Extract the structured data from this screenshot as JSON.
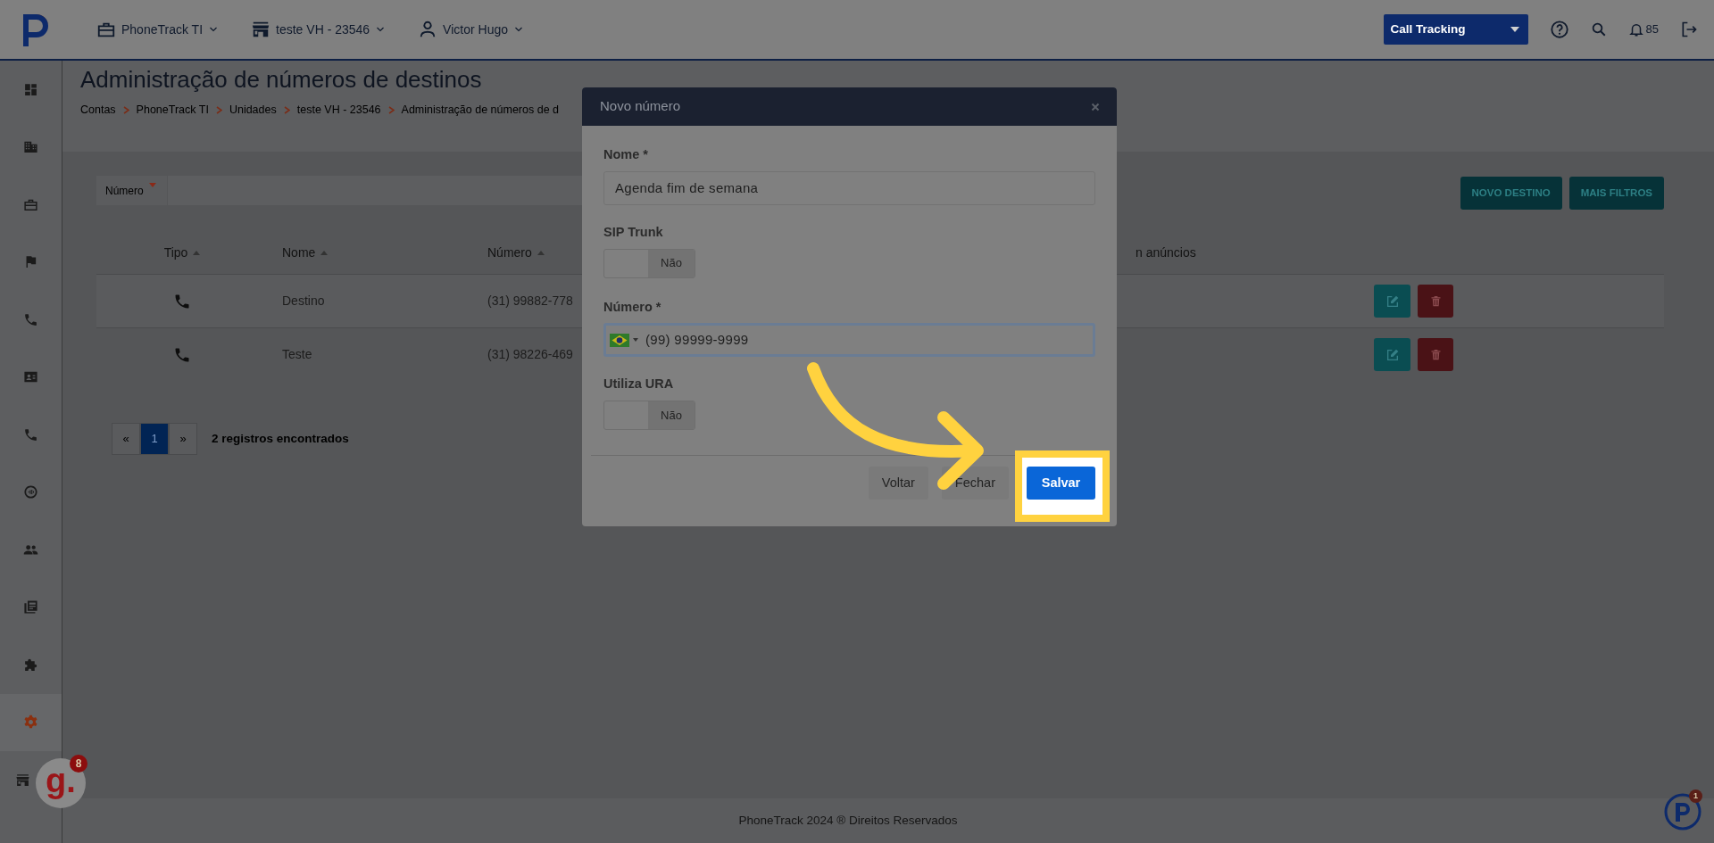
{
  "header": {
    "nav": [
      {
        "label": "PhoneTrack TI"
      },
      {
        "label": "teste VH - 23546"
      },
      {
        "label": "Victor Hugo"
      }
    ],
    "product_select": "Call Tracking",
    "notifications": "85"
  },
  "sidebar": {
    "items": [
      {
        "selected": false
      },
      {
        "selected": false
      },
      {
        "selected": false
      },
      {
        "selected": false
      },
      {
        "selected": false
      },
      {
        "selected": false
      },
      {
        "selected": false
      },
      {
        "selected": false
      },
      {
        "selected": false
      },
      {
        "selected": false
      },
      {
        "selected": false
      },
      {
        "selected": true
      },
      {
        "selected": false
      }
    ]
  },
  "page": {
    "title": "Administração de números de destinos",
    "breadcrumb": [
      "Contas",
      "PhoneTrack TI",
      "Unidades",
      "teste VH - 23546",
      "Administração de números de d"
    ]
  },
  "filter": {
    "field": "Número"
  },
  "actions": [
    "NOVO DESTINO",
    "MAIS FILTROS"
  ],
  "table": {
    "columns": [
      {
        "label": "Tipo",
        "sortable": true
      },
      {
        "label": "Nome",
        "sortable": true
      },
      {
        "label": "Número",
        "sortable": true
      },
      {
        "label": "n anúncios",
        "sortable": false
      }
    ],
    "rows": [
      {
        "nome": "Destino",
        "numero": "(31) 99882-778"
      },
      {
        "nome": "Teste",
        "numero": "(31) 98226-469"
      }
    ]
  },
  "pagination": {
    "pages": [
      {
        "label": "«",
        "selected": false
      },
      {
        "label": "1",
        "selected": true
      },
      {
        "label": "»",
        "selected": false
      }
    ],
    "summary": "2 registros encontrados"
  },
  "footer": "PhoneTrack 2024 ® Direitos Reservados",
  "modal": {
    "title": "Novo número",
    "fields": [
      {
        "kind": "text",
        "label": "Nome *",
        "value": "Agenda fim de semana",
        "focused": false
      },
      {
        "kind": "toggle",
        "label": "SIP Trunk",
        "on": false,
        "off_text": "Não"
      },
      {
        "kind": "phone",
        "label": "Número *",
        "value": "(99) 99999-9999",
        "focused": true
      },
      {
        "kind": "toggle",
        "label": "Utiliza URA",
        "on": false,
        "off_text": "Não"
      }
    ],
    "buttons": [
      {
        "label": "Voltar",
        "kind": "secondary",
        "highlighted": false
      },
      {
        "label": "Fechar",
        "kind": "secondary",
        "highlighted": false
      },
      {
        "label": "Salvar",
        "kind": "primary",
        "highlighted": true
      }
    ]
  },
  "help_widget": {
    "logo_text": "g.",
    "badge": "8"
  },
  "chat_widget": {
    "badge": "1"
  }
}
